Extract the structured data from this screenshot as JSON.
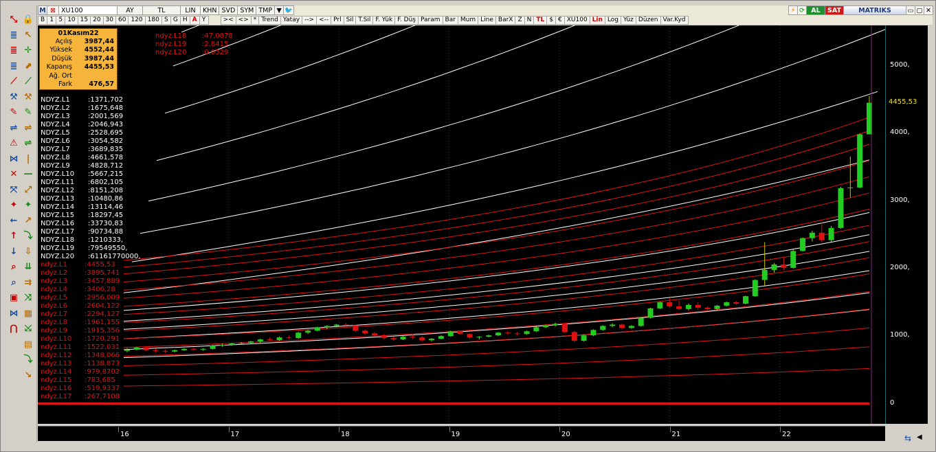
{
  "toolbar1": {
    "symbol": "XU100",
    "period": "AY",
    "currency": "TL",
    "scale": "LIN",
    "buttons": [
      "KHN",
      "SVD",
      "SYM",
      "TMP"
    ],
    "al_label": "AL",
    "sat_label": "SAT",
    "brand": "MATRIKS"
  },
  "toolbar2": {
    "intervals": [
      "B",
      "1",
      "5",
      "10",
      "15",
      "20",
      "30",
      "60",
      "120",
      "180",
      "S",
      "G",
      "H",
      "A",
      "Y"
    ],
    "active_interval": "A",
    "tools": [
      ">< ",
      "<>",
      "*",
      "Trend",
      "Yatay",
      "-->",
      "<--",
      "Prl",
      "Sil",
      "T.Sil",
      "F. Yük",
      "F. Düş",
      "Param",
      "Bar",
      "Mum",
      "Line",
      "BarX",
      "Z",
      "N",
      "TL",
      "$",
      "€",
      "XU100",
      "Lin",
      "Log",
      "Yüz",
      "Düzen",
      "Var.Kyd"
    ]
  },
  "info": {
    "date": "01Kasım22",
    "rows": [
      {
        "k": "Açılış",
        "v": "3987,44"
      },
      {
        "k": "Yüksek",
        "v": "4552,44"
      },
      {
        "k": "Düşük",
        "v": "3987,44"
      },
      {
        "k": "Kapanış",
        "v": "4455,53"
      },
      {
        "k": "Ağ. Ort",
        "v": ""
      },
      {
        "k": "Fark",
        "v": "476,57"
      }
    ]
  },
  "legend_top": [
    {
      "name": "ndyz.L18",
      "value": ":47,0878"
    },
    {
      "name": "ndyz.L19",
      "value": ":2,8415"
    },
    {
      "name": "ndyz.L20",
      "value": ":0,0329"
    }
  ],
  "legend_white": [
    {
      "name": "NDYZ.L1",
      "value": ":1371,702"
    },
    {
      "name": "NDYZ.L2",
      "value": ":1675,648"
    },
    {
      "name": "NDYZ.L3",
      "value": ":2001,569"
    },
    {
      "name": "NDYZ.L4",
      "value": ":2046,943"
    },
    {
      "name": "NDYZ.L5",
      "value": ":2528,695"
    },
    {
      "name": "NDYZ.L6",
      "value": ":3054,582"
    },
    {
      "name": "NDYZ.L7",
      "value": ":3689,835"
    },
    {
      "name": "NDYZ.L8",
      "value": ":4661,578"
    },
    {
      "name": "NDYZ.L9",
      "value": ":4828,712"
    },
    {
      "name": "NDYZ.L10",
      "value": ":5667,215"
    },
    {
      "name": "NDYZ.L11",
      "value": ":6802,105"
    },
    {
      "name": "NDYZ.L12",
      "value": ":8151,208"
    },
    {
      "name": "NDYZ.L13",
      "value": ":10480,86"
    },
    {
      "name": "NDYZ.L14",
      "value": ":13114,46"
    },
    {
      "name": "NDYZ.L15",
      "value": ":18297,45"
    },
    {
      "name": "NDYZ.L16",
      "value": ":33730,83"
    },
    {
      "name": "NDYZ.L17",
      "value": ":90734,88"
    },
    {
      "name": "NDYZ.L18",
      "value": ":1210333,"
    },
    {
      "name": "NDYZ.L19",
      "value": ":79549550,"
    },
    {
      "name": "NDYZ.L20",
      "value": ":61161770000,"
    }
  ],
  "legend_red": [
    {
      "name": "ndyz.L1",
      "value": ":4455,53"
    },
    {
      "name": "ndyz.L2",
      "value": ":3895,741"
    },
    {
      "name": "ndyz.L3",
      "value": ":3457,889"
    },
    {
      "name": "ndyz.L4",
      "value": ":3406,28"
    },
    {
      "name": "ndyz.L5",
      "value": ":2956,009"
    },
    {
      "name": "ndyz.L6",
      "value": ":2604,122"
    },
    {
      "name": "ndyz.L7",
      "value": ":2294,127"
    },
    {
      "name": "ndyz.L8",
      "value": ":1961,155"
    },
    {
      "name": "ndyz.L9",
      "value": ":1915,356"
    },
    {
      "name": "ndyz.L10",
      "value": ":1720,291"
    },
    {
      "name": "ndyz.L11",
      "value": ":1522,031"
    },
    {
      "name": "ndyz.L12",
      "value": ":1348,066"
    },
    {
      "name": "ndyz.L13",
      "value": ":1138,873"
    },
    {
      "name": "ndyz.L14",
      "value": ":979,8702"
    },
    {
      "name": "ndyz.L15",
      "value": ":783,685"
    },
    {
      "name": "ndyz.L16",
      "value": ":519,9337"
    },
    {
      "name": "ndyz.L17",
      "value": ":267,7108"
    }
  ],
  "yaxis": {
    "ticks": [
      {
        "v": 5000,
        "label": "5000,"
      },
      {
        "v": 4000,
        "label": "4000,"
      },
      {
        "v": 3000,
        "label": "3000,"
      },
      {
        "v": 2000,
        "label": "2000,"
      },
      {
        "v": 1000,
        "label": "1000,"
      },
      {
        "v": 0,
        "label": "0"
      }
    ],
    "last_price": "4455,53"
  },
  "xaxis": {
    "labels": [
      "16",
      "17",
      "18",
      "19",
      "20",
      "21",
      "22"
    ]
  },
  "colors": {
    "up": "#22cc22",
    "down": "#dd1111",
    "white_channel": "#ffffff",
    "red_channel": "#e01414",
    "info_bg": "#f6b43a"
  },
  "chart_data": {
    "type": "candlestick",
    "ylim": [
      -300,
      5600
    ],
    "candles": [
      [
        780,
        820,
        760,
        800
      ],
      [
        800,
        840,
        790,
        830
      ],
      [
        830,
        850,
        780,
        790
      ],
      [
        790,
        810,
        760,
        780
      ],
      [
        780,
        800,
        750,
        770
      ],
      [
        770,
        800,
        760,
        790
      ],
      [
        790,
        820,
        780,
        810
      ],
      [
        810,
        830,
        790,
        800
      ],
      [
        800,
        820,
        780,
        810
      ],
      [
        810,
        870,
        800,
        860
      ],
      [
        860,
        890,
        840,
        870
      ],
      [
        870,
        900,
        860,
        890
      ],
      [
        890,
        910,
        870,
        900
      ],
      [
        900,
        930,
        890,
        920
      ],
      [
        920,
        960,
        900,
        950
      ],
      [
        950,
        980,
        930,
        940
      ],
      [
        940,
        990,
        930,
        980
      ],
      [
        980,
        1010,
        960,
        970
      ],
      [
        970,
        1060,
        960,
        1050
      ],
      [
        1050,
        1090,
        1030,
        1080
      ],
      [
        1080,
        1140,
        1070,
        1130
      ],
      [
        1130,
        1160,
        1100,
        1150
      ],
      [
        1150,
        1180,
        1130,
        1170
      ],
      [
        1170,
        1190,
        1150,
        1160
      ],
      [
        1160,
        1170,
        1060,
        1080
      ],
      [
        1080,
        1100,
        1020,
        1040
      ],
      [
        1040,
        1060,
        990,
        1010
      ],
      [
        1010,
        1030,
        950,
        970
      ],
      [
        970,
        990,
        930,
        950
      ],
      [
        950,
        1000,
        940,
        990
      ],
      [
        990,
        1020,
        960,
        980
      ],
      [
        980,
        1000,
        920,
        940
      ],
      [
        940,
        970,
        920,
        960
      ],
      [
        960,
        1010,
        950,
        1000
      ],
      [
        1000,
        1080,
        990,
        1070
      ],
      [
        1070,
        1080,
        1020,
        1030
      ],
      [
        1030,
        1040,
        960,
        980
      ],
      [
        980,
        1000,
        950,
        990
      ],
      [
        990,
        1020,
        980,
        1010
      ],
      [
        1010,
        1060,
        1000,
        1050
      ],
      [
        1050,
        1070,
        1020,
        1040
      ],
      [
        1040,
        1060,
        1010,
        1030
      ],
      [
        1030,
        1080,
        1020,
        1070
      ],
      [
        1070,
        1140,
        1060,
        1130
      ],
      [
        1130,
        1170,
        1120,
        1160
      ],
      [
        1160,
        1200,
        1140,
        1180
      ],
      [
        1180,
        1190,
        1040,
        1060
      ],
      [
        1060,
        1080,
        910,
        930
      ],
      [
        930,
        1020,
        920,
        1010
      ],
      [
        1010,
        1100,
        1000,
        1090
      ],
      [
        1090,
        1160,
        1080,
        1150
      ],
      [
        1150,
        1190,
        1130,
        1170
      ],
      [
        1170,
        1180,
        1100,
        1120
      ],
      [
        1120,
        1160,
        1110,
        1150
      ],
      [
        1150,
        1280,
        1140,
        1270
      ],
      [
        1270,
        1420,
        1260,
        1410
      ],
      [
        1410,
        1510,
        1400,
        1500
      ],
      [
        1500,
        1560,
        1420,
        1440
      ],
      [
        1440,
        1520,
        1380,
        1400
      ],
      [
        1400,
        1480,
        1380,
        1460
      ],
      [
        1460,
        1500,
        1390,
        1420
      ],
      [
        1420,
        1440,
        1380,
        1400
      ],
      [
        1400,
        1460,
        1390,
        1450
      ],
      [
        1450,
        1510,
        1440,
        1500
      ],
      [
        1500,
        1520,
        1460,
        1480
      ],
      [
        1480,
        1600,
        1470,
        1590
      ],
      [
        1590,
        1840,
        1580,
        1830
      ],
      [
        1830,
        2390,
        1750,
        1980
      ],
      [
        1980,
        2080,
        1940,
        2060
      ],
      [
        2060,
        2150,
        1980,
        2010
      ],
      [
        2010,
        2280,
        2000,
        2260
      ],
      [
        2260,
        2460,
        2250,
        2450
      ],
      [
        2450,
        2560,
        2400,
        2530
      ],
      [
        2530,
        2690,
        2390,
        2420
      ],
      [
        2420,
        2630,
        2380,
        2600
      ],
      [
        2600,
        3210,
        2590,
        3190
      ],
      [
        3190,
        3660,
        3050,
        3200
      ],
      [
        3200,
        4000,
        3190,
        3987
      ],
      [
        3987,
        4552,
        3987,
        4455
      ]
    ]
  }
}
